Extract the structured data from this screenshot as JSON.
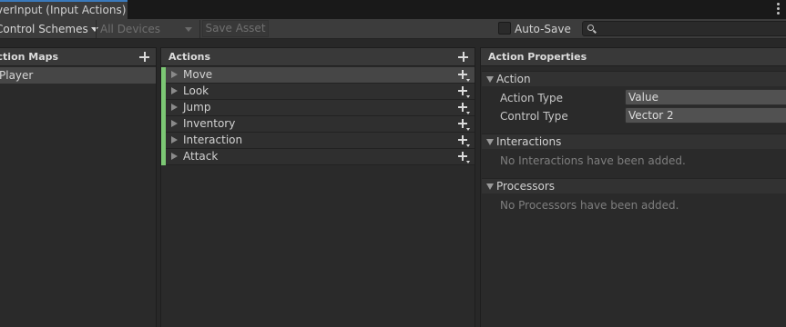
{
  "window": {
    "tab_title": "verInput (Input Actions)"
  },
  "toolbar": {
    "control_schemes": "Control Schemes",
    "all_devices": "All Devices",
    "save_asset": "Save Asset",
    "auto_save_label": "Auto-Save",
    "auto_save_checked": false,
    "search_value": ""
  },
  "action_maps": {
    "header": "Action Maps",
    "items": [
      {
        "label": "Player",
        "selected": true
      }
    ]
  },
  "actions": {
    "header": "Actions",
    "items": [
      {
        "label": "Move",
        "selected": true
      },
      {
        "label": "Look",
        "selected": false
      },
      {
        "label": "Jump",
        "selected": false
      },
      {
        "label": "Inventory",
        "selected": false
      },
      {
        "label": "Interaction",
        "selected": false
      },
      {
        "label": "Attack",
        "selected": false
      }
    ]
  },
  "properties": {
    "header": "Action Properties",
    "action_section": "Action",
    "action_type_label": "Action Type",
    "action_type_value": "Value",
    "control_type_label": "Control Type",
    "control_type_value": "Vector 2",
    "interactions_section": "Interactions",
    "interactions_empty": "No Interactions have been added.",
    "processors_section": "Processors",
    "processors_empty": "No Processors have been added."
  },
  "colors": {
    "accent_tab": "#3a79bb",
    "action_strip": "#7cc874",
    "selected_row": "#464646"
  }
}
